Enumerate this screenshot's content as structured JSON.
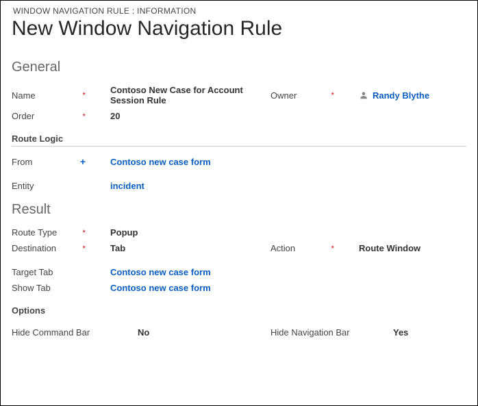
{
  "breadcrumb": "WINDOW NAVIGATION RULE : INFORMATION",
  "title": "New Window Navigation Rule",
  "general": {
    "heading": "General",
    "name": {
      "label": "Name",
      "value": "Contoso New Case for Account Session Rule",
      "required": true
    },
    "owner": {
      "label": "Owner",
      "value": "Randy Blythe",
      "required": true
    },
    "order": {
      "label": "Order",
      "value": "20",
      "required": true
    },
    "routeLogic": {
      "heading": "Route Logic",
      "from": {
        "label": "From",
        "value": "Contoso new case form",
        "recommended": true
      },
      "entity": {
        "label": "Entity",
        "value": "incident"
      }
    }
  },
  "result": {
    "heading": "Result",
    "routeType": {
      "label": "Route Type",
      "value": "Popup",
      "required": true
    },
    "destination": {
      "label": "Destination",
      "value": "Tab",
      "required": true
    },
    "action": {
      "label": "Action",
      "value": "Route Window",
      "required": true
    },
    "targetTab": {
      "label": "Target Tab",
      "value": "Contoso new case form"
    },
    "showTab": {
      "label": "Show Tab",
      "value": "Contoso new case form"
    },
    "options": {
      "heading": "Options",
      "hideCommandBar": {
        "label": "Hide Command Bar",
        "value": "No"
      },
      "hideNavBar": {
        "label": "Hide Navigation Bar",
        "value": "Yes"
      }
    }
  }
}
